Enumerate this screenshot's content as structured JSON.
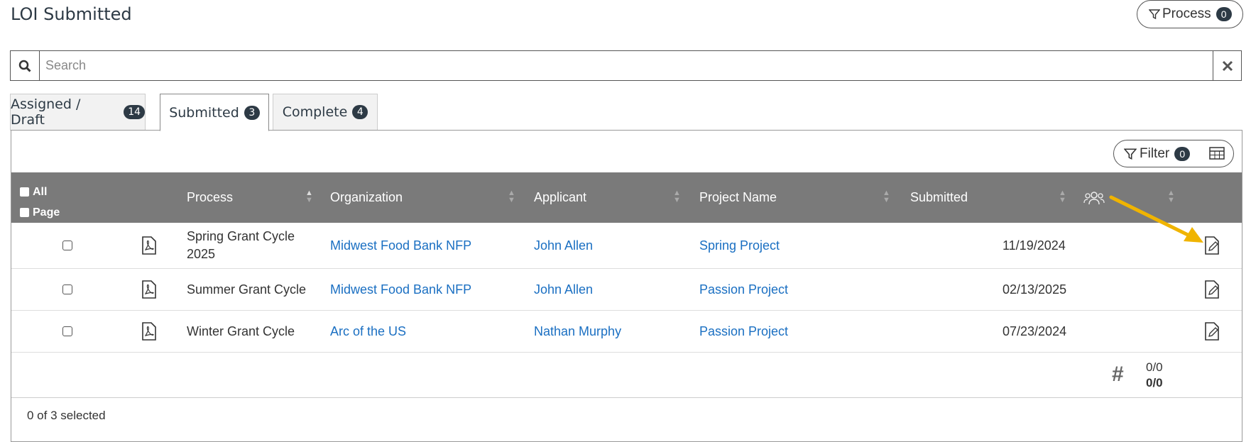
{
  "page_title": "LOI Submitted",
  "process_button": {
    "label": "Process",
    "count": "0"
  },
  "search": {
    "placeholder": "Search"
  },
  "tabs": [
    {
      "label": "Assigned / Draft",
      "count": "14"
    },
    {
      "label": "Submitted",
      "count": "3"
    },
    {
      "label": "Complete",
      "count": "4"
    }
  ],
  "filter_button": {
    "label": "Filter",
    "count": "0"
  },
  "table": {
    "select_all": "All",
    "select_page": "Page",
    "columns": [
      "Process",
      "Organization",
      "Applicant",
      "Project Name",
      "Submitted"
    ],
    "rows": [
      {
        "process": "Spring Grant Cycle 2025",
        "organization": "Midwest Food Bank NFP",
        "applicant": "John Allen",
        "project": "Spring Project",
        "submitted": "11/19/2024"
      },
      {
        "process": "Summer Grant Cycle",
        "organization": "Midwest Food Bank NFP",
        "applicant": "John Allen",
        "project": "Passion Project",
        "submitted": "02/13/2025"
      },
      {
        "process": "Winter Grant Cycle",
        "organization": "Arc of the US",
        "applicant": "Nathan Murphy",
        "project": "Passion Project",
        "submitted": "07/23/2024"
      }
    ]
  },
  "pager": {
    "top": "0/0",
    "bottom": "0/0"
  },
  "selection_status": "0 of 3 selected",
  "colors": {
    "header_bg": "#7a7a7a",
    "link": "#1a6fc2",
    "badge": "#2d3a45",
    "arrow": "#f0b400"
  },
  "icons": {
    "search": "search-icon",
    "clear": "close-icon",
    "filter": "filter-icon",
    "grid": "table-grid-icon",
    "pdf": "pdf-icon",
    "edit": "edit-document-icon",
    "people": "people-icon",
    "hash": "hash-icon"
  }
}
